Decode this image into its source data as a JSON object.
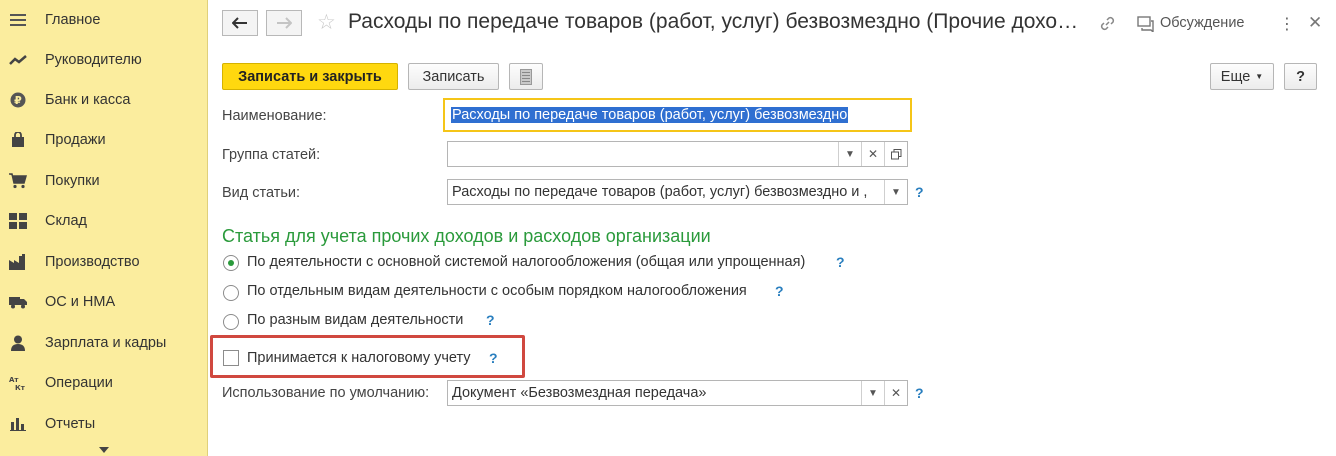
{
  "sidebar": {
    "items": [
      {
        "label": "Главное",
        "icon": "menu-lines-icon"
      },
      {
        "label": "Руководителю",
        "icon": "trend-icon"
      },
      {
        "label": "Банк и касса",
        "icon": "ruble-coin-icon"
      },
      {
        "label": "Продажи",
        "icon": "shopping-bag-icon"
      },
      {
        "label": "Покупки",
        "icon": "cart-icon"
      },
      {
        "label": "Склад",
        "icon": "warehouse-icon"
      },
      {
        "label": "Производство",
        "icon": "factory-icon"
      },
      {
        "label": "ОС и НМА",
        "icon": "truck-icon"
      },
      {
        "label": "Зарплата и кадры",
        "icon": "person-icon"
      },
      {
        "label": "Операции",
        "icon": "dt-kt-icon"
      },
      {
        "label": "Отчеты",
        "icon": "bar-chart-icon"
      }
    ]
  },
  "header": {
    "title": "Расходы по передаче товаров (работ, услуг) безвозмездно (Прочие дохо…",
    "discussion_label": "Обсуждение"
  },
  "toolbar": {
    "save_close_label": "Записать и закрыть",
    "save_label": "Записать",
    "more_label": "Еще",
    "help_label": "?"
  },
  "form": {
    "name_label": "Наименование:",
    "name_value": "Расходы по передаче товаров (работ, услуг) безвозмездно",
    "group_label": "Группа статей:",
    "group_value": "",
    "type_label": "Вид статьи:",
    "type_value": "Расходы по передаче товаров (работ, услуг) безвозмездно и ,",
    "section_title": "Статья для учета прочих доходов и расходов организации",
    "radio_options": [
      {
        "label": "По деятельности с основной системой налогообложения (общая или упрощенная)",
        "selected": true
      },
      {
        "label": "По отдельным видам деятельности с особым порядком налогообложения",
        "selected": false
      },
      {
        "label": "По разным видам деятельности",
        "selected": false
      }
    ],
    "tax_checkbox_label": "Принимается к налоговому учету",
    "tax_checkbox_checked": false,
    "default_usage_label": "Использование по умолчанию:",
    "default_usage_value": "Документ «Безвозмездная передача»",
    "help_mark": "?"
  },
  "colors": {
    "sidebar_bg": "#fbed9e",
    "primary_button": "#ffd80f",
    "section_title": "#2a9a3b",
    "help_mark": "#2a7fbf",
    "highlight_frame": "#d0483f",
    "focused_field_border": "#f5c518",
    "selection_bg": "#2f6fd1"
  }
}
